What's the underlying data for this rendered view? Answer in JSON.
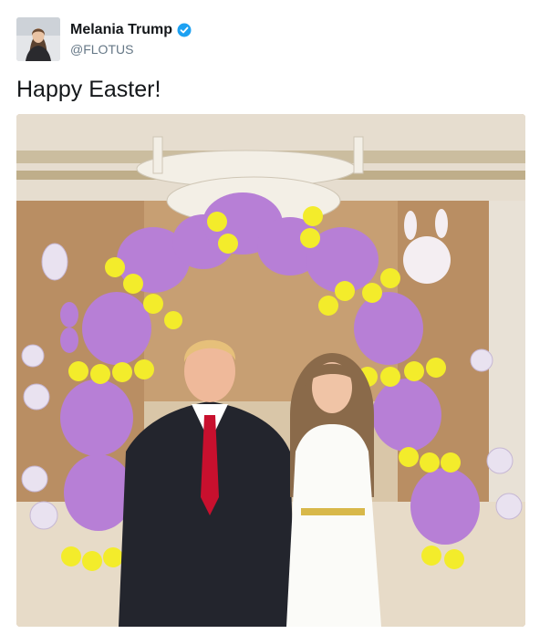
{
  "tweet": {
    "author": {
      "display_name": "Melania Trump",
      "handle": "@FLOTUS",
      "verified": true,
      "avatar_icon": "profile-photo"
    },
    "text": "Happy Easter!",
    "media": {
      "type": "photo",
      "icon": "photo-easter-balloon-arch"
    }
  },
  "colors": {
    "verified_badge": "#1da1f2",
    "handle_text": "#657786",
    "balloon_purple": "#b77fd6",
    "balloon_yellow": "#f3ec2b"
  }
}
